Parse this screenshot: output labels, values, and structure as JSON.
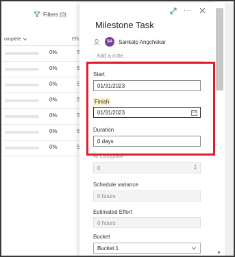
{
  "toolbar": {
    "filters_label": "Filters (0)"
  },
  "grid": {
    "col_complete": "omplete",
    "col_effort": "Effo",
    "rows": [
      {
        "percent": "0%"
      },
      {
        "percent": "0%"
      },
      {
        "percent": "0%"
      },
      {
        "percent": "0%"
      },
      {
        "percent": "0%"
      },
      {
        "percent": "0%"
      },
      {
        "percent": "0%"
      }
    ],
    "row_suffix": "S"
  },
  "panel": {
    "title": "Milestone Task",
    "assignee_initials": "SA",
    "assignee_name": "Sankalp Angchekar",
    "note_placeholder": "Add a note...",
    "start_label": "Start",
    "start_value": "01/31/2023",
    "finish_label": "Finish",
    "finish_value": "01/31/2023",
    "duration_label": "Duration",
    "duration_value": "0 days",
    "complete_label": "% Complete",
    "complete_value": "0",
    "schedule_variance_label": "Schedule variance",
    "schedule_variance_value": "0 hours",
    "estimated_effort_label": "Estimated Effort",
    "estimated_effort_value": "0 hours",
    "bucket_label": "Bucket",
    "bucket_value": "Bucket 1"
  },
  "colors": {
    "highlight": "#e01c2a",
    "avatar": "#7a3d9a",
    "expand_icon": "#1e9d5a",
    "finish_highlight": "#fbf1c4"
  }
}
